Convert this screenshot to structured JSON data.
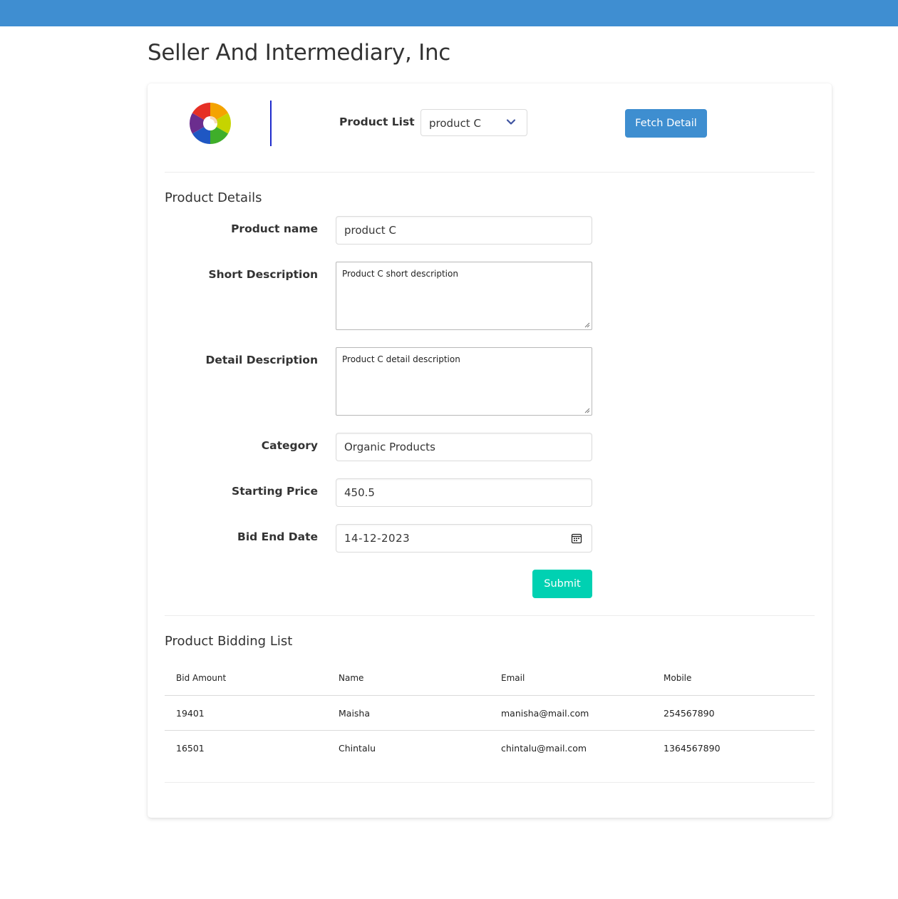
{
  "header": {
    "title": "Seller And Intermediary, Inc"
  },
  "toolbar": {
    "product_list_label": "Product List",
    "selected_product": "product C",
    "fetch_label": "Fetch Detail"
  },
  "details": {
    "section_title": "Product Details",
    "product_name_label": "Product name",
    "product_name": "product C",
    "short_desc_label": "Short Description",
    "short_desc": "Product C short description",
    "detail_desc_label": "Detail Description",
    "detail_desc": "Product C detail description",
    "category_label": "Category",
    "category": "Organic Products",
    "price_label": "Starting Price",
    "price": "450.5",
    "bid_end_label": "Bid End Date",
    "bid_end": "14-12-2023",
    "submit_label": "Submit"
  },
  "bids": {
    "section_title": "Product Bidding List",
    "columns": [
      "Bid Amount",
      "Name",
      "Email",
      "Mobile"
    ],
    "rows": [
      [
        "19401",
        "Maisha",
        "manisha@mail.com",
        "254567890"
      ],
      [
        "16501",
        "Chintalu",
        "chintalu@mail.com",
        "1364567890"
      ]
    ]
  },
  "colors": {
    "topbar": "#3f8ed1",
    "fetch_button": "#3e8ed0",
    "submit_button": "#00d1b2",
    "divider": "#1e2bcc"
  },
  "icons": [
    "logo-icon",
    "chevron-down-icon",
    "calendar-icon"
  ]
}
